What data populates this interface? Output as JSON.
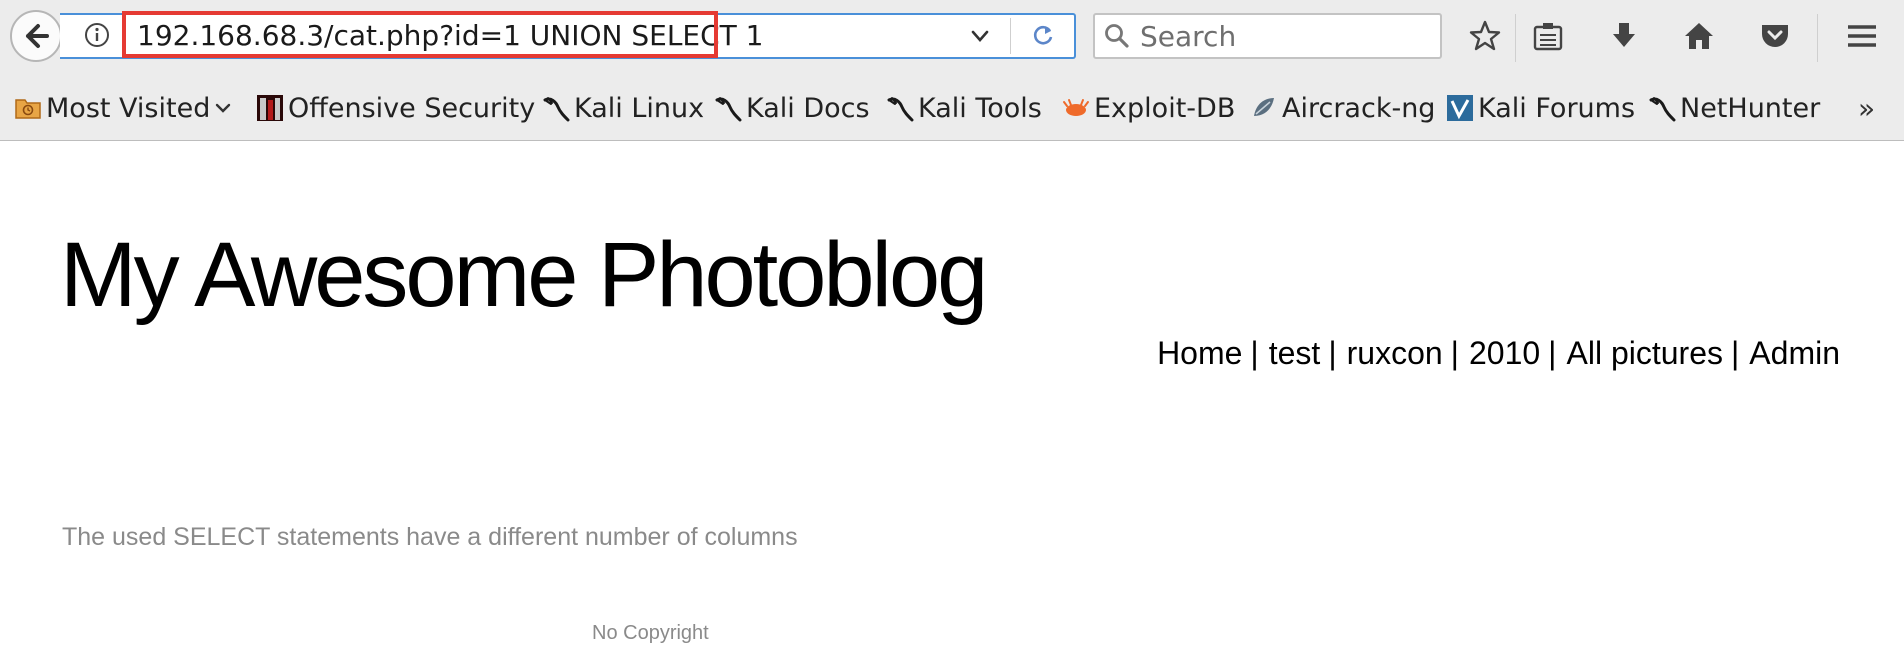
{
  "browser": {
    "url": "192.168.68.3/cat.php?id=1 UNION SELECT 1",
    "search_placeholder": "Search",
    "bookmarks": [
      {
        "label": "Most Visited",
        "icon": "folder-icon"
      },
      {
        "label": "Offensive Security",
        "icon": "offensive-security-icon"
      },
      {
        "label": "Kali Linux",
        "icon": "kali-dragon-icon"
      },
      {
        "label": "Kali Docs",
        "icon": "kali-dragon-icon"
      },
      {
        "label": "Kali Tools",
        "icon": "kali-dragon-icon"
      },
      {
        "label": "Exploit-DB",
        "icon": "exploit-db-icon"
      },
      {
        "label": "Aircrack-ng",
        "icon": "aircrack-icon"
      },
      {
        "label": "Kali Forums",
        "icon": "kali-forums-icon"
      },
      {
        "label": "NetHunter",
        "icon": "kali-dragon-icon"
      }
    ],
    "more_bookmarks": "»",
    "colors": {
      "chrome_bg": "#ececec",
      "url_focus_border": "#4a90d9",
      "highlight_box": "#e53a33"
    }
  },
  "page": {
    "title": "My Awesome Photoblog",
    "nav": [
      {
        "label": "Home"
      },
      {
        "label": "test"
      },
      {
        "label": "ruxcon"
      },
      {
        "label": "2010"
      },
      {
        "label": "All pictures"
      },
      {
        "label": "Admin"
      }
    ],
    "nav_separator": "|",
    "error_message": "The used SELECT statements have a different number of columns",
    "footer": "No Copyright"
  }
}
